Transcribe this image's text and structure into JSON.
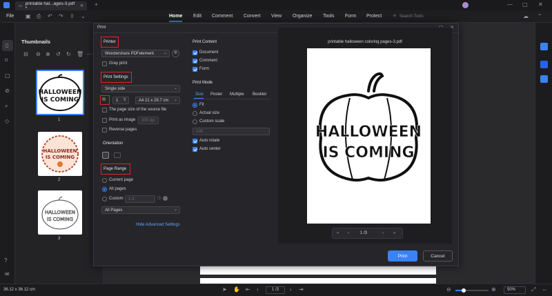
{
  "app": {
    "file_tab": "printable hal...ages-3.pdf *",
    "file_menu": "File"
  },
  "menu": {
    "items": [
      "Home",
      "Edit",
      "Comment",
      "Convert",
      "View",
      "Organize",
      "Tools",
      "Form",
      "Protect"
    ],
    "active": "Home",
    "search": "Search Tools"
  },
  "thumbnails": {
    "title": "Thumbnails",
    "pages": [
      "1",
      "2",
      "3"
    ]
  },
  "dialog": {
    "title": "Print",
    "printer_label": "Printer",
    "printer_value": "Wondershare PDFelement",
    "gray_print": "Gray print",
    "print_settings_label": "Print Settings",
    "side_value": "Single side",
    "copies": "1",
    "paper_size": "A4 21 x 29.7 cm",
    "page_size_source": "The page size of the source file",
    "print_as_image": "Print as image",
    "dpi": "300 dpi",
    "reverse_pages": "Reverse pages",
    "orientation_label": "Orientation",
    "page_range_label": "Page Range",
    "current_page": "Current page",
    "all_pages": "All pages",
    "custom": "Custom",
    "custom_value": "1-3",
    "custom_of": "/3",
    "all_pages_select": "All Pages",
    "hide_advanced": "Hide Advanced Settings",
    "print_content_label": "Print Content",
    "document": "Document",
    "comment": "Comment",
    "form": "Form",
    "print_mode_label": "Print Mode",
    "mode_tabs": [
      "Size",
      "Poster",
      "Multiple",
      "Booklet"
    ],
    "active_mode": "Size",
    "fit": "Fit",
    "actual_size": "Actual size",
    "custom_scale": "Custom scale",
    "scale_value": "100",
    "auto_rotate": "Auto rotate",
    "auto_center": "Auto center",
    "preview_title": "printable halloween coloring pages-3.pdf",
    "preview_page": "1 /3",
    "print_button": "Print",
    "cancel_button": "Cancel",
    "art_line1": "HALLOWEEN",
    "art_line2": "IS COMING"
  },
  "status": {
    "dimensions": "36.12 x 36.12 cm",
    "page": "1 /3",
    "zoom": "50%"
  },
  "colors": {
    "accent": "#3b82f6",
    "highlight": "#e0242c",
    "dialog_bg": "#26262a"
  }
}
